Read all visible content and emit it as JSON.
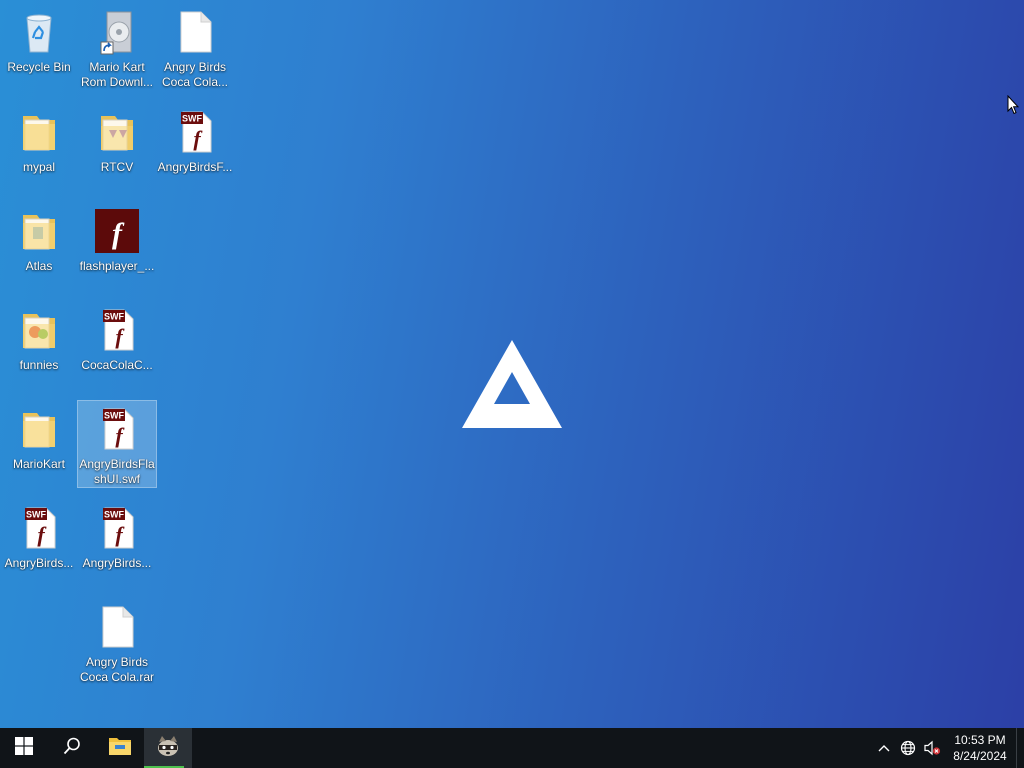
{
  "desktop": {
    "icons": [
      {
        "name": "recycle-bin",
        "label": "Recycle Bin",
        "icon": "recycle-bin-icon"
      },
      {
        "name": "mario-kart-rom-download",
        "label": "Mario Kart Rom Downl...",
        "icon": "shortcut-icon"
      },
      {
        "name": "angry-birds-coca-cola-file",
        "label": "Angry Birds Coca Cola...",
        "icon": "blank-file-icon"
      },
      {
        "name": "folder-mypal",
        "label": "mypal",
        "icon": "folder-icon"
      },
      {
        "name": "folder-rtcv",
        "label": "RTCV",
        "icon": "folder-icon"
      },
      {
        "name": "swf-angrybirdsf",
        "label": "AngryBirdsF...",
        "icon": "swf-file-icon"
      },
      {
        "name": "folder-atlas",
        "label": "Atlas",
        "icon": "folder-icon"
      },
      {
        "name": "flashplayer",
        "label": "flashplayer_...",
        "icon": "flash-player-icon"
      },
      {
        "name": "folder-funnies",
        "label": "funnies",
        "icon": "folder-icon"
      },
      {
        "name": "swf-cocacolac",
        "label": "CocaColaC...",
        "icon": "swf-file-icon"
      },
      {
        "name": "folder-mariokart",
        "label": "MarioKart",
        "icon": "folder-icon"
      },
      {
        "name": "swf-angrybirdsflashui",
        "label": "AngryBirdsFlashUI.swf",
        "icon": "swf-file-icon",
        "selected": true
      },
      {
        "name": "swf-angrybirds-1",
        "label": "AngryBirds...",
        "icon": "swf-file-icon"
      },
      {
        "name": "swf-angrybirds-2",
        "label": "AngryBirds...",
        "icon": "swf-file-icon"
      },
      {
        "name": "angry-birds-coca-cola-rar",
        "label": "Angry Birds Coca Cola.rar",
        "icon": "blank-file-icon"
      }
    ],
    "swf_badge": "SWF"
  },
  "taskbar": {
    "start": "windows-start-icon",
    "search": "search-icon",
    "explorer": "file-explorer-icon",
    "active_app": "raccoon-app-icon"
  },
  "tray": {
    "icons": [
      "chevron-up-icon",
      "globe-network-icon",
      "speaker-muted-icon"
    ],
    "time": "10:53 PM",
    "date": "8/24/2024"
  },
  "colors": {
    "accent": "#4ec14e",
    "taskbar": "#101418",
    "flash_red": "#6b0d0d"
  }
}
